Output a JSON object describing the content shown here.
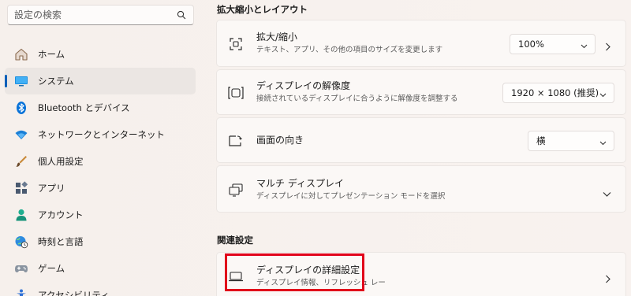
{
  "search": {
    "placeholder": "設定の検索"
  },
  "sidebar": {
    "items": [
      {
        "label": "ホーム",
        "icon": "home-icon"
      },
      {
        "label": "システム",
        "icon": "monitor-icon",
        "selected": true
      },
      {
        "label": "Bluetooth とデバイス",
        "icon": "bluetooth-icon"
      },
      {
        "label": "ネットワークとインターネット",
        "icon": "wifi-icon"
      },
      {
        "label": "個人用設定",
        "icon": "brush-icon"
      },
      {
        "label": "アプリ",
        "icon": "apps-icon"
      },
      {
        "label": "アカウント",
        "icon": "person-icon"
      },
      {
        "label": "時刻と言語",
        "icon": "globe-clock-icon"
      },
      {
        "label": "ゲーム",
        "icon": "gamepad-icon"
      },
      {
        "label": "アクセシビリティ",
        "icon": "accessibility-icon"
      }
    ]
  },
  "scale_section": {
    "title": "拡大縮小とレイアウト",
    "scale": {
      "title": "拡大/縮小",
      "subtitle": "テキスト、アプリ、その他の項目のサイズを変更します",
      "value": "100%"
    },
    "resolution": {
      "title": "ディスプレイの解像度",
      "subtitle": "接続されているディスプレイに合うように解像度を調整する",
      "value": "1920 × 1080 (推奨)"
    },
    "orientation": {
      "title": "画面の向き",
      "value": "横"
    },
    "multi": {
      "title": "マルチ ディスプレイ",
      "subtitle": "ディスプレイに対してプレゼンテーション モードを選択"
    }
  },
  "related_section": {
    "title": "関連設定",
    "advanced": {
      "title": "ディスプレイの詳細設定",
      "subtitle": "ディスプレイ情報、リフレッシュ レー"
    }
  },
  "colors": {
    "accent": "#005fb8",
    "highlight": "#e1001a"
  }
}
